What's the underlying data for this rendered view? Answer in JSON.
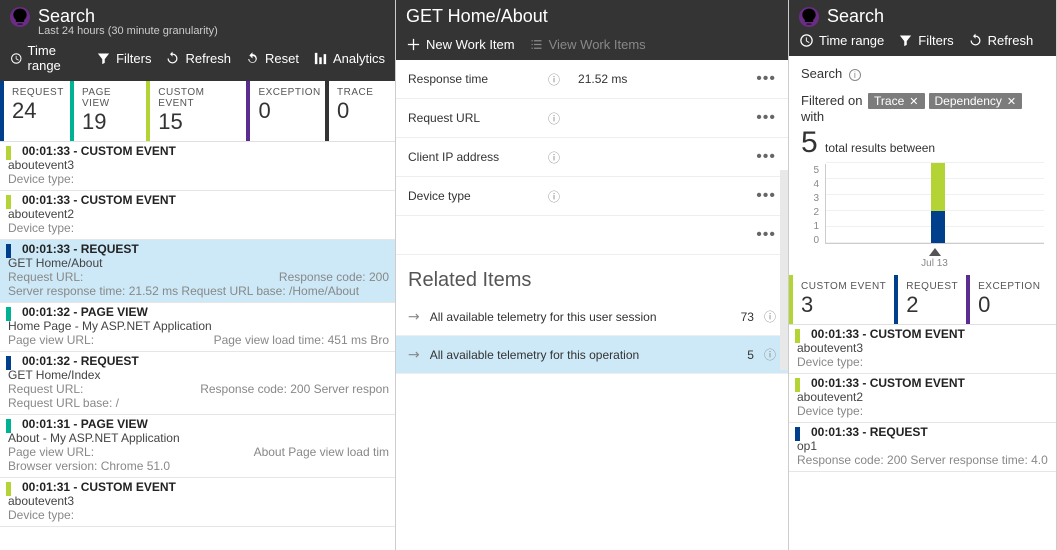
{
  "left": {
    "title": "Search",
    "subtitle": "Last 24 hours (30 minute granularity)",
    "toolbar": {
      "time_range": "Time range",
      "filters": "Filters",
      "refresh": "Refresh",
      "reset": "Reset",
      "analytics": "Analytics"
    },
    "stats": {
      "request": {
        "label": "REQUEST",
        "value": "24"
      },
      "page_view": {
        "label": "PAGE VIEW",
        "value": "19"
      },
      "custom_event": {
        "label": "CUSTOM EVENT",
        "value": "15"
      },
      "exception": {
        "label": "EXCEPTION",
        "value": "0"
      },
      "trace": {
        "label": "TRACE",
        "value": "0"
      }
    },
    "items": [
      {
        "type": "ce",
        "time": "00:01:33 - CUSTOM EVENT",
        "l1": "aboutevent3",
        "l2": "Device type:"
      },
      {
        "type": "ce",
        "time": "00:01:33 - CUSTOM EVENT",
        "l1": "aboutevent2",
        "l2": "Device type:"
      },
      {
        "type": "req",
        "time": "00:01:33 - REQUEST",
        "l1": "GET  Home/About",
        "l2a": "Request URL:",
        "l2b": "Response code: 200",
        "l3": "Server response time: 21.52 ms  Request URL base: /Home/About",
        "selected": true
      },
      {
        "type": "pv",
        "time": "00:01:32 - PAGE VIEW",
        "l1": "Home Page - My ASP.NET Application",
        "l2a": "Page view URL:",
        "l2b": "Page view load time: 451 ms  Bro"
      },
      {
        "type": "req",
        "time": "00:01:32 - REQUEST",
        "l1": "GET  Home/Index",
        "l2a": "Request URL:",
        "l2b": "Response code: 200  Server respon",
        "l3": "Request URL base: /"
      },
      {
        "type": "pv",
        "time": "00:01:31 - PAGE VIEW",
        "l1": "About - My ASP.NET Application",
        "l2a": "Page view URL:",
        "l2b": "About  Page view load tim",
        "l3": "Browser version: Chrome 51.0"
      },
      {
        "type": "ce",
        "time": "00:01:31 - CUSTOM EVENT",
        "l1": "aboutevent3",
        "l2": "Device type:"
      }
    ]
  },
  "center": {
    "title": "GET Home/About",
    "toolbar": {
      "new_work": "New Work Item",
      "view_work": "View Work Items"
    },
    "props": [
      {
        "label": "Response time",
        "value": "21.52 ms"
      },
      {
        "label": "Request URL",
        "value": ""
      },
      {
        "label": "Client IP address",
        "value": ""
      },
      {
        "label": "Device type",
        "value": ""
      }
    ],
    "related_title": "Related Items",
    "related": [
      {
        "text": "All available telemetry for this user session",
        "count": "73"
      },
      {
        "text": "All available telemetry for this operation",
        "count": "5",
        "selected": true
      }
    ]
  },
  "right": {
    "title": "Search",
    "toolbar": {
      "time_range": "Time range",
      "filters": "Filters",
      "refresh": "Refresh"
    },
    "search_label": "Search",
    "filtered_on": "Filtered on",
    "chips": [
      "Trace",
      "Dependency"
    ],
    "with_text": "with",
    "total_count": "5",
    "total_suffix": "total results between",
    "xdate": "Jul 13",
    "stats": {
      "custom_event": {
        "label": "CUSTOM EVENT",
        "value": "3"
      },
      "request": {
        "label": "REQUEST",
        "value": "2"
      },
      "exception": {
        "label": "EXCEPTION",
        "value": "0"
      }
    },
    "items": [
      {
        "type": "ce",
        "time": "00:01:33 - CUSTOM EVENT",
        "l1": "aboutevent3",
        "l2": "Device type:"
      },
      {
        "type": "ce",
        "time": "00:01:33 - CUSTOM EVENT",
        "l1": "aboutevent2",
        "l2": "Device type:"
      },
      {
        "type": "req",
        "time": "00:01:33 - REQUEST",
        "l1": "op1",
        "l2": "Response code: 200  Server response time: 4.0"
      }
    ]
  },
  "chart_data": {
    "type": "bar",
    "categories": [
      "Jul 13"
    ],
    "series": [
      {
        "name": "CUSTOM EVENT",
        "color": "#b4d334",
        "values": [
          3
        ]
      },
      {
        "name": "REQUEST",
        "color": "#003f8c",
        "values": [
          2
        ]
      }
    ],
    "stacked_totals": [
      5
    ],
    "ylim": [
      0,
      5
    ],
    "yticks": [
      0,
      1,
      2,
      3,
      4,
      5
    ],
    "title": "",
    "xlabel": "",
    "ylabel": ""
  },
  "colors": {
    "req": "#003f8c",
    "pv": "#00b294",
    "ce": "#b4d334",
    "ex": "#5c2d91",
    "tr": "#333333"
  }
}
